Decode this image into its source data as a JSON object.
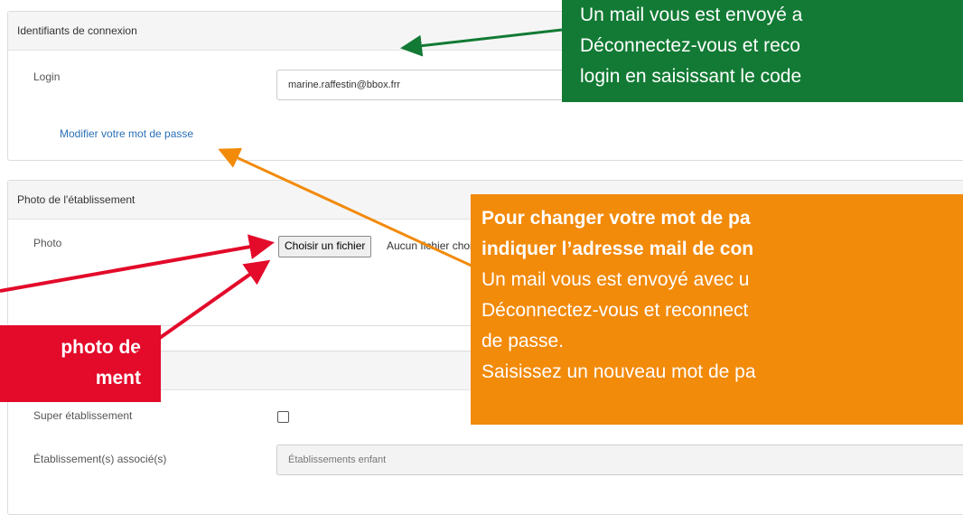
{
  "section_login": {
    "title": "Identifiants de connexion",
    "login_label": "Login",
    "login_value": "marine.raffestin@bbox.frr",
    "change_password_link": "Modifier votre mot de passe"
  },
  "section_photo": {
    "title": "Photo de l'établissement",
    "photo_label": "Photo",
    "choose_file_button": "Choisir un fichier",
    "no_file_text": "Aucun fichier choisi"
  },
  "section_group": {
    "super_label": "Super établissement",
    "associated_label": "Établissement(s) associé(s)",
    "associated_placeholder": "Établissements enfant"
  },
  "callouts": {
    "green": {
      "line1": "Un mail vous est envoyé a",
      "line2": "Déconnectez-vous et reco",
      "line3": "login en saisissant le code"
    },
    "orange": {
      "line1": "Pour changer votre mot de pa",
      "line2": "indiquer l’adresse mail de con",
      "line3": "Un mail vous est envoyé avec u",
      "line4": "Déconnectez-vous et reconnect",
      "line5": "de passe.",
      "line6": "Saisissez un nouveau mot de pa"
    },
    "red": {
      "line1": "photo de",
      "line2": "ment"
    }
  },
  "colors": {
    "green": "#127a34",
    "orange": "#f28a0a",
    "red": "#e30a2a",
    "link": "#2a6fb5"
  }
}
